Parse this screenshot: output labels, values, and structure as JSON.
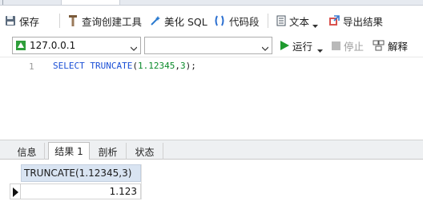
{
  "toolbar": {
    "save_label": "保存",
    "query_builder_label": "查询创建工具",
    "beautify_sql_label": "美化 SQL",
    "code_snippet_label": "代码段",
    "text_label": "文本",
    "export_label": "导出结果"
  },
  "connection": {
    "server_value": "127.0.0.1",
    "database_value": "",
    "run_label": "运行",
    "stop_label": "停止",
    "explain_label": "解释"
  },
  "editor": {
    "line_number": "1",
    "code_keyword": "SELECT TRUNCATE",
    "code_paren_open": "(",
    "code_arg1": "1.12345",
    "code_comma": ",",
    "code_arg2": "3",
    "code_tail": ");"
  },
  "result_tabs": [
    {
      "label": "信息"
    },
    {
      "label": "结果 1"
    },
    {
      "label": "剖析"
    },
    {
      "label": "状态"
    }
  ],
  "result_grid": {
    "column_header": "TRUNCATE(1.12345,3)",
    "cell_value": "1.123"
  },
  "colors": {
    "keyword": "#1a4fd6",
    "number": "#0a8a2a",
    "run_green": "#1e9a2e",
    "grid_header": "#d9e4f2"
  }
}
